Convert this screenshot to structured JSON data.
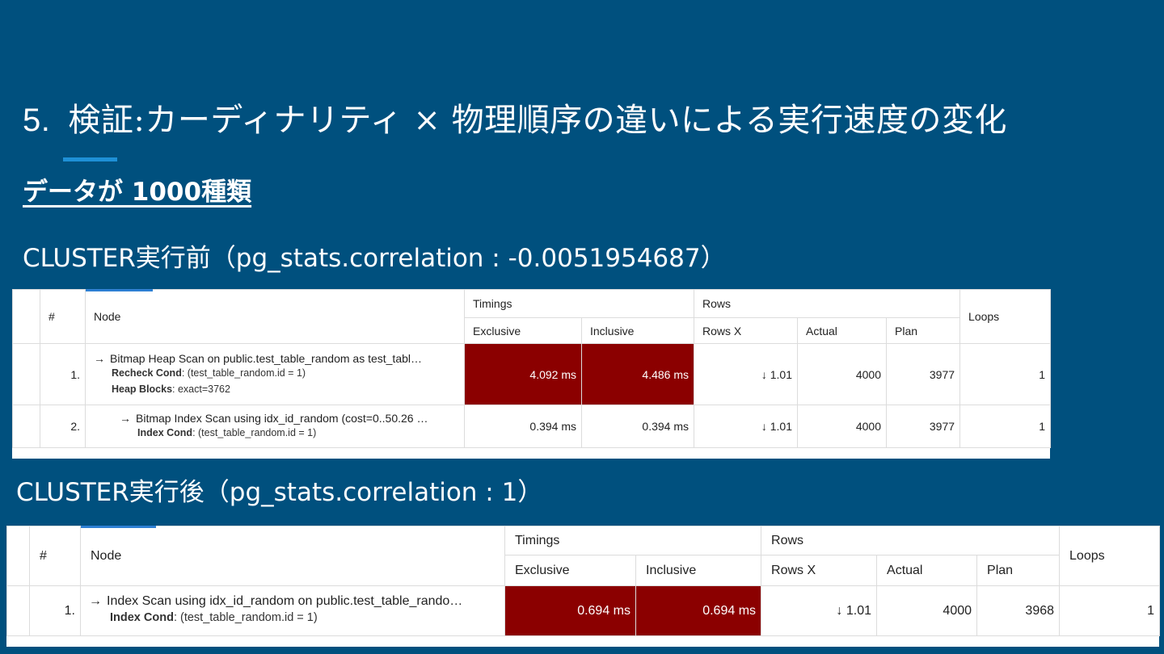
{
  "slide": {
    "title_number": "5.",
    "title_text": "検証:カーディナリティ × 物理順序の違いによる実行速度の変化",
    "subtitle": "データが 1000種類",
    "section_before": "CLUSTER実行前（pg_stats.correlation : -0.0051954687）",
    "section_after": "CLUSTER実行後（pg_stats.correlation : 1）"
  },
  "colors": {
    "background": "#00507e",
    "hot_cell": "#8b0000",
    "accent": "#1e90d6"
  },
  "headers": {
    "hash": "#",
    "node": "Node",
    "timings": "Timings",
    "rows": "Rows",
    "loops": "Loops",
    "exclusive": "Exclusive",
    "inclusive": "Inclusive",
    "rows_x": "Rows X",
    "actual": "Actual",
    "plan": "Plan"
  },
  "table_before": {
    "rows": [
      {
        "index": "1.",
        "arrow": "→",
        "node": "Bitmap Heap Scan on public.test_table_random as test_tabl…",
        "details": [
          {
            "key": "Recheck Cond",
            "value": ": (test_table_random.id = 1)"
          },
          {
            "key": "Heap Blocks",
            "value": ": exact=3762"
          }
        ],
        "exclusive": "4.092 ms",
        "inclusive": "4.486 ms",
        "rows_x": "↓ 1.01",
        "actual": "4000",
        "plan": "3977",
        "loops": "1"
      },
      {
        "index": "2.",
        "arrow": "→",
        "node": "Bitmap Index Scan using idx_id_random (cost=0..50.26 …",
        "details": [
          {
            "key": "Index Cond",
            "value": ": (test_table_random.id = 1)"
          }
        ],
        "exclusive": "0.394 ms",
        "inclusive": "0.394 ms",
        "rows_x": "↓ 1.01",
        "actual": "4000",
        "plan": "3977",
        "loops": "1"
      }
    ]
  },
  "table_after": {
    "rows": [
      {
        "index": "1.",
        "arrow": "→",
        "node": "Index Scan using idx_id_random on public.test_table_rando…",
        "details": [
          {
            "key": "Index Cond",
            "value": ": (test_table_random.id = 1)"
          }
        ],
        "exclusive": "0.694 ms",
        "inclusive": "0.694 ms",
        "rows_x": "↓ 1.01",
        "actual": "4000",
        "plan": "3968",
        "loops": "1"
      }
    ]
  }
}
